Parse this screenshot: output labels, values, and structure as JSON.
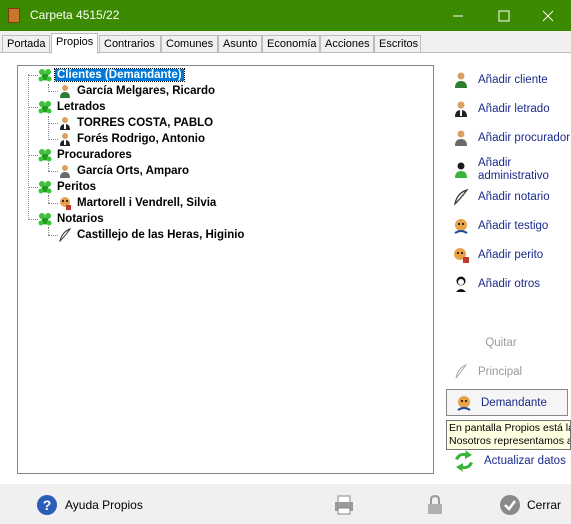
{
  "window": {
    "title": "Carpeta 4515/22"
  },
  "tabs": [
    {
      "label": "Portada"
    },
    {
      "label": "Propios"
    },
    {
      "label": "Contrarios"
    },
    {
      "label": "Comunes"
    },
    {
      "label": "Asunto"
    },
    {
      "label": "Economía"
    },
    {
      "label": "Acciones"
    },
    {
      "label": "Escritos"
    }
  ],
  "tree": {
    "groups": [
      {
        "label": "Clientes (Demandante)",
        "children": [
          "García Melgares, Ricardo"
        ]
      },
      {
        "label": "Letrados",
        "children": [
          "TORRES COSTA, PABLO",
          "Forés Rodrigo, Antonio"
        ]
      },
      {
        "label": "Procuradores",
        "children": [
          "García Orts, Amparo"
        ]
      },
      {
        "label": "Peritos",
        "children": [
          "Martorell i Vendrell, Silvia"
        ]
      },
      {
        "label": "Notarios",
        "children": [
          "Castillejo de las Heras, Higinio"
        ]
      }
    ]
  },
  "side": {
    "add_cliente": "Añadir cliente",
    "add_letrado": "Añadir letrado",
    "add_procurador": "Añadir procurador",
    "add_administrativo_1": "Añadir",
    "add_administrativo_2": "administrativo",
    "add_notario": "Añadir notario",
    "add_testigo": "Añadir testigo",
    "add_perito": "Añadir perito",
    "add_otros": "Añadir otros",
    "quitar": "Quitar",
    "principal": "Principal",
    "demandante": "Demandante",
    "tooltip_1": "En pantalla Propios está la",
    "tooltip_2": "Nosotros representamos a",
    "actualizar": "Actualizar datos"
  },
  "footer": {
    "ayuda": "Ayuda Propios",
    "cerrar": "Cerrar"
  },
  "colors": {
    "titlebar": "#3c8a00",
    "link": "#1a2a8a",
    "selection": "#0078d7"
  }
}
